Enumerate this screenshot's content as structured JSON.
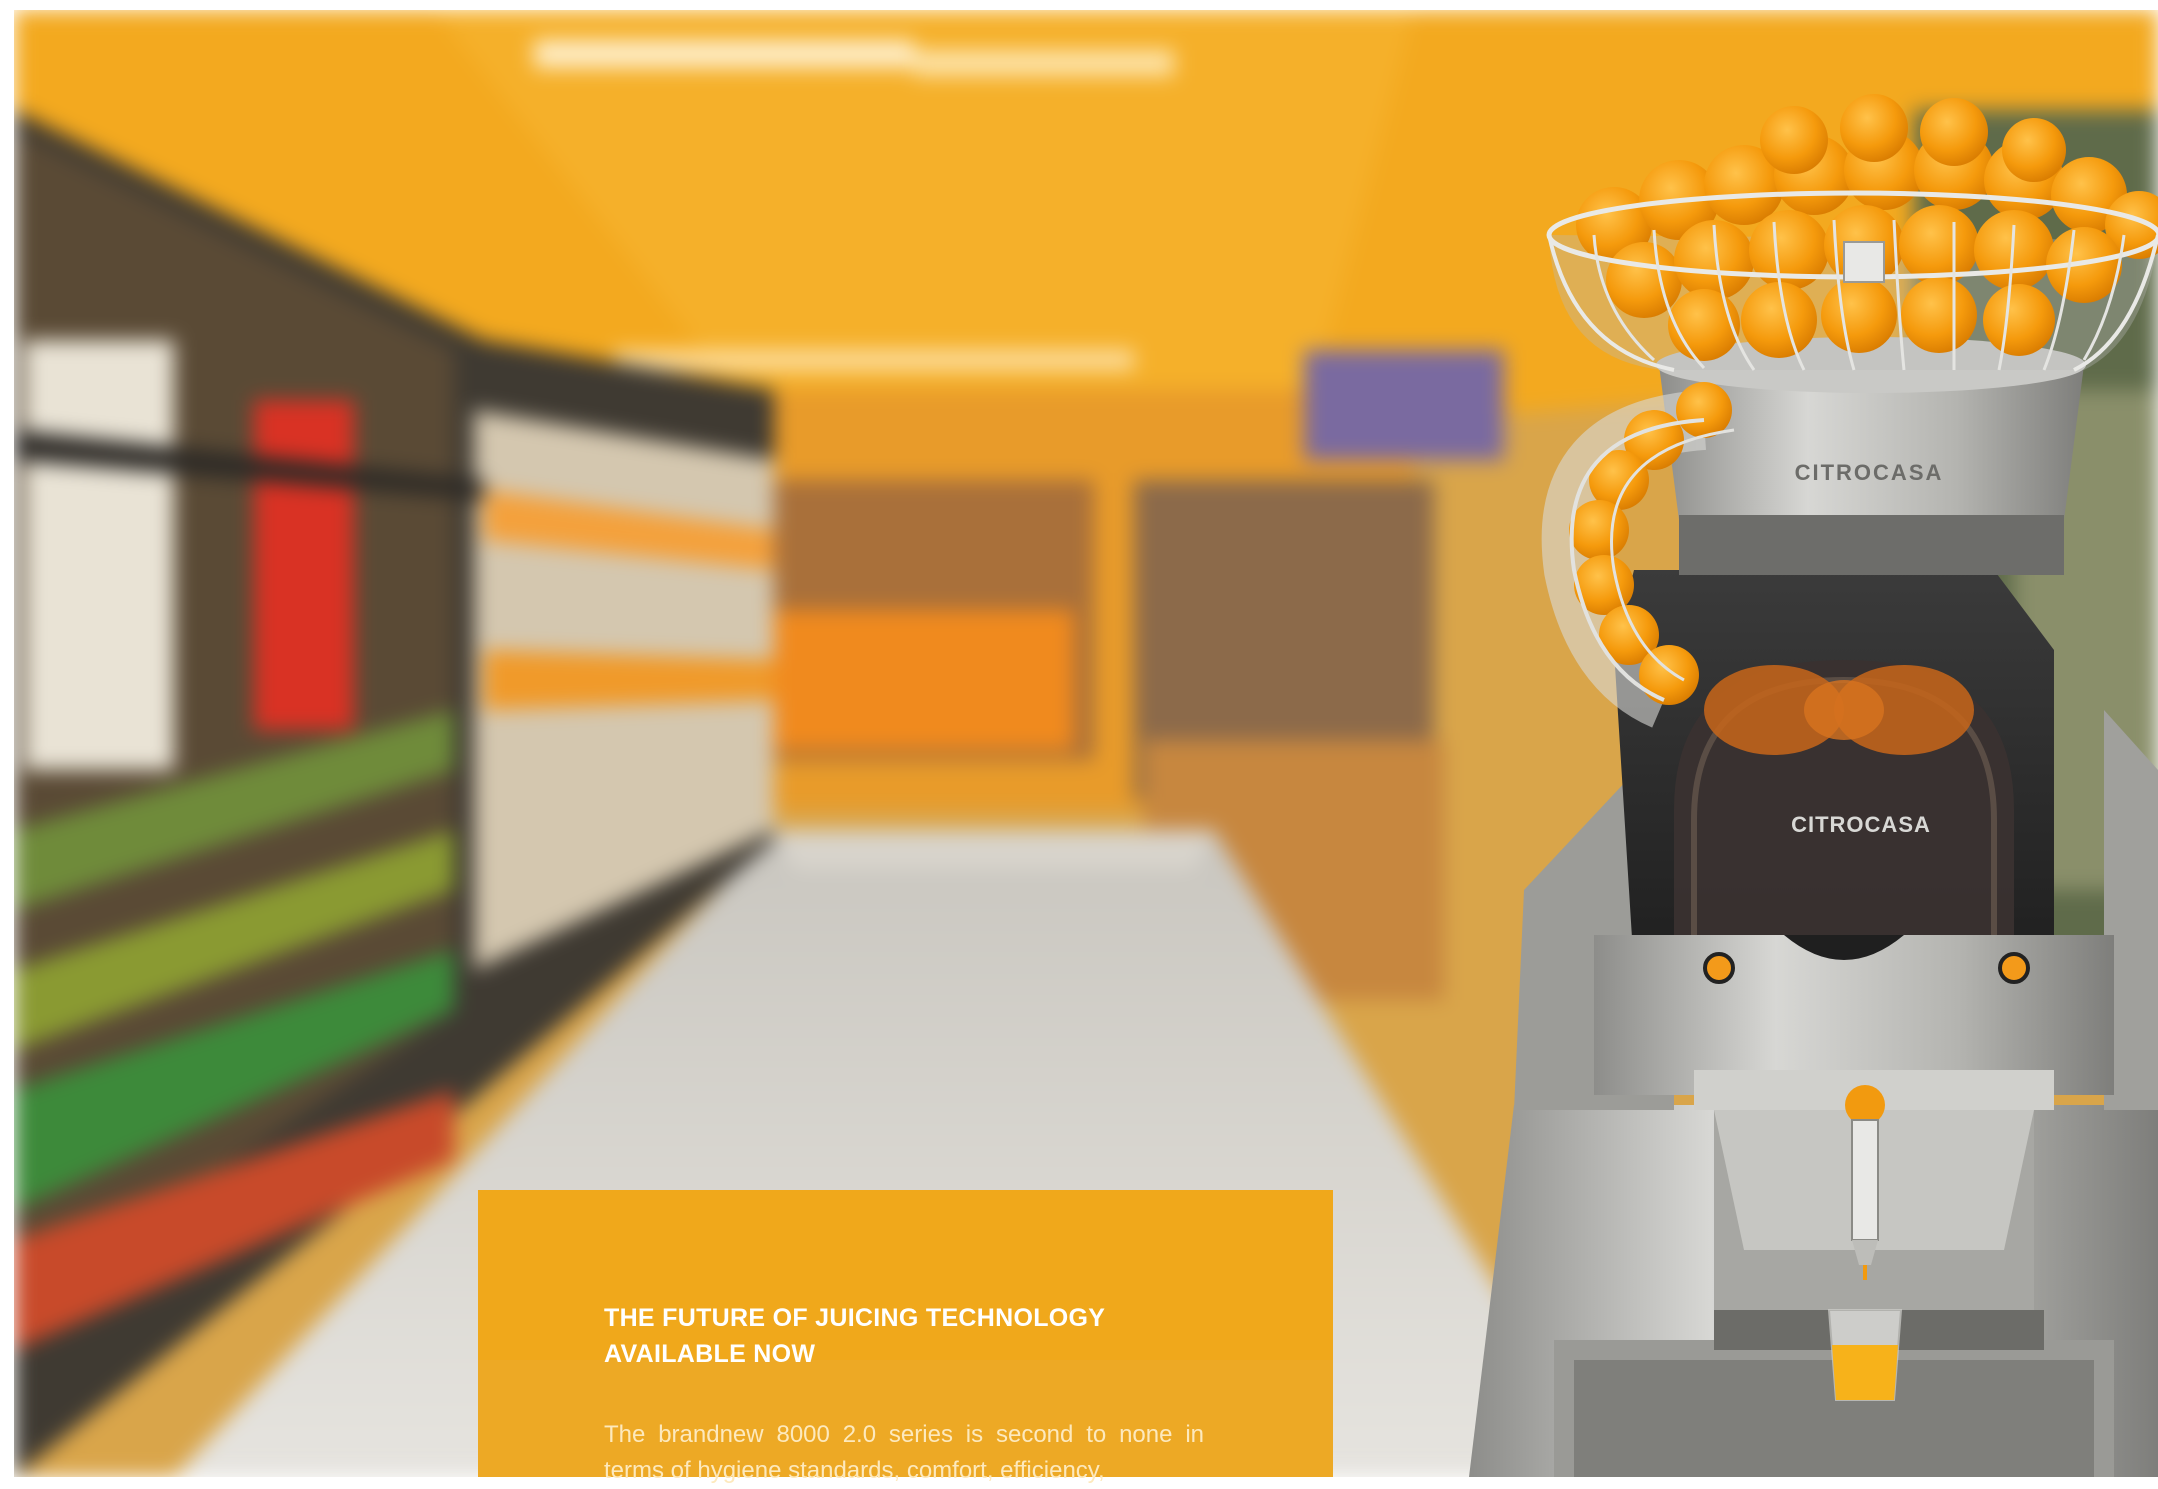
{
  "hero": {
    "title": "THE FUTURE OF JUICING TECHNOLOGY AVAILABLE NOW",
    "body": "The brandnew 8000 2.0 series is second to none in terms of hygiene standards, comfort, efficiency,"
  },
  "machine": {
    "brand_collar": "CITROCASA",
    "brand_front": "CITROCASA"
  },
  "colors": {
    "accent": "#f0a81b",
    "ceiling": "#f3a91f",
    "steel": "#b9b9b6",
    "orange_fruit": "#f59a0c"
  },
  "icons": [
    "orange-juicer-machine",
    "orange-basket",
    "juice-glass",
    "supermarket-aisle"
  ]
}
